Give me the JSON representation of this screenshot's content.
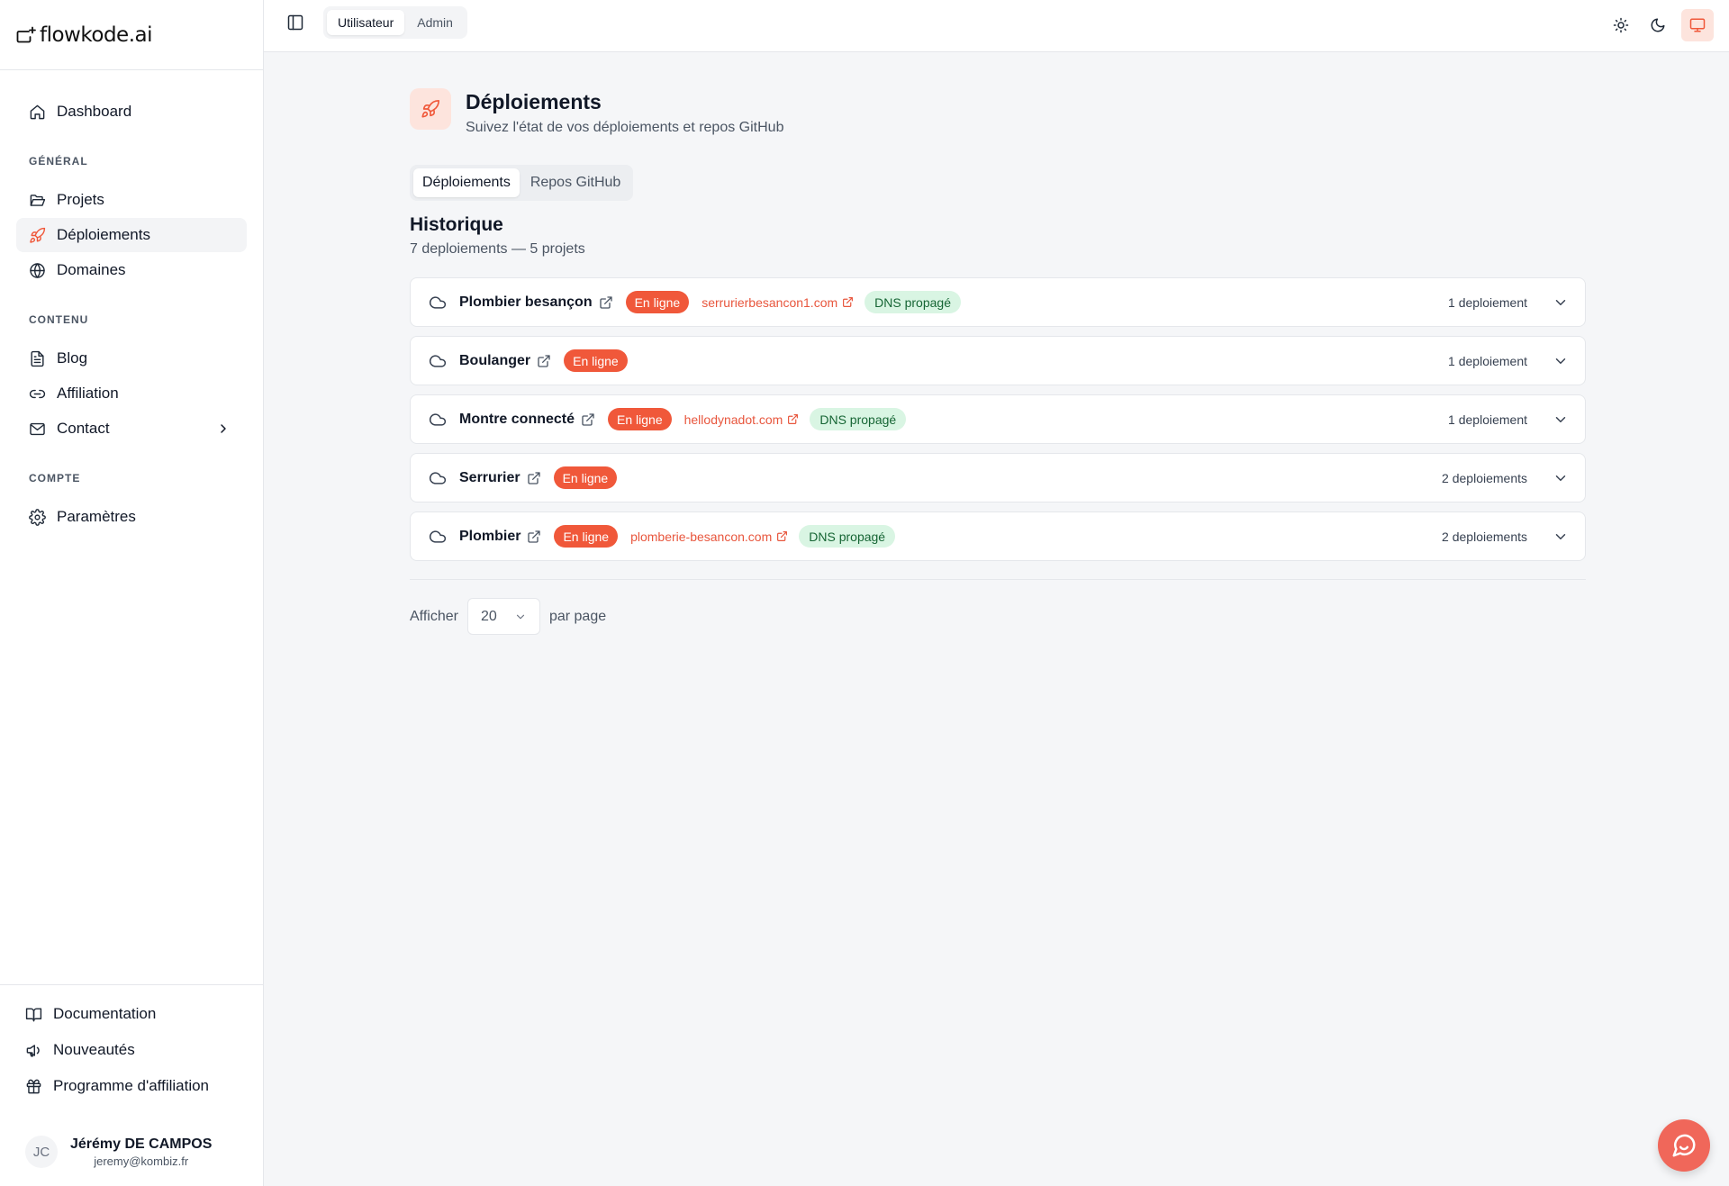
{
  "app": {
    "logo": "flowkode.ai"
  },
  "sidebar": {
    "dashboard": "Dashboard",
    "sections": {
      "general": "GÉNÉRAL",
      "content": "CONTENU",
      "account": "COMPTE"
    },
    "items": {
      "projects": "Projets",
      "deployments": "Déploiements",
      "domains": "Domaines",
      "blog": "Blog",
      "affiliation": "Affiliation",
      "contact": "Contact",
      "settings": "Paramètres"
    },
    "bottom": {
      "documentation": "Documentation",
      "news": "Nouveautés",
      "affiliate_program": "Programme d'affiliation"
    },
    "user": {
      "initials": "JC",
      "name": "Jérémy DE CAMPOS",
      "email": "jeremy@kombiz.fr"
    }
  },
  "topbar": {
    "roles": [
      "Utilisateur",
      "Admin"
    ],
    "active_role": "Utilisateur",
    "theme_icons": [
      "sun-icon",
      "moon-icon",
      "monitor-icon"
    ],
    "active_theme": "monitor-icon"
  },
  "page": {
    "title": "Déploiements",
    "subtitle": "Suivez l'état de vos déploiements et repos GitHub",
    "tabs": [
      "Déploiements",
      "Repos GitHub"
    ],
    "active_tab": "Déploiements",
    "history_title": "Historique",
    "history_sub": "7 deploiements — 5 projets"
  },
  "deployments": [
    {
      "name": "Plombier besançon",
      "status": "En ligne",
      "domain": "serrurierbesancon1.com",
      "dns": "DNS propagé",
      "count": "1 deploiement"
    },
    {
      "name": "Boulanger",
      "status": "En ligne",
      "domain": "",
      "dns": "",
      "count": "1 deploiement"
    },
    {
      "name": "Montre connecté",
      "status": "En ligne",
      "domain": "hellodynadot.com",
      "dns": "DNS propagé",
      "count": "1 deploiement"
    },
    {
      "name": "Serrurier",
      "status": "En ligne",
      "domain": "",
      "dns": "",
      "count": "2 deploiements"
    },
    {
      "name": "Plombier",
      "status": "En ligne",
      "domain": "plomberie-besancon.com",
      "dns": "DNS propagé",
      "count": "2 deploiements"
    }
  ],
  "pagination": {
    "before": "Afficher",
    "value": "20",
    "after": "par page"
  },
  "colors": {
    "accent": "#f0583a",
    "accent_soft": "#fde4dd",
    "dns_bg": "#d9f5e3",
    "dns_text": "#166534"
  }
}
